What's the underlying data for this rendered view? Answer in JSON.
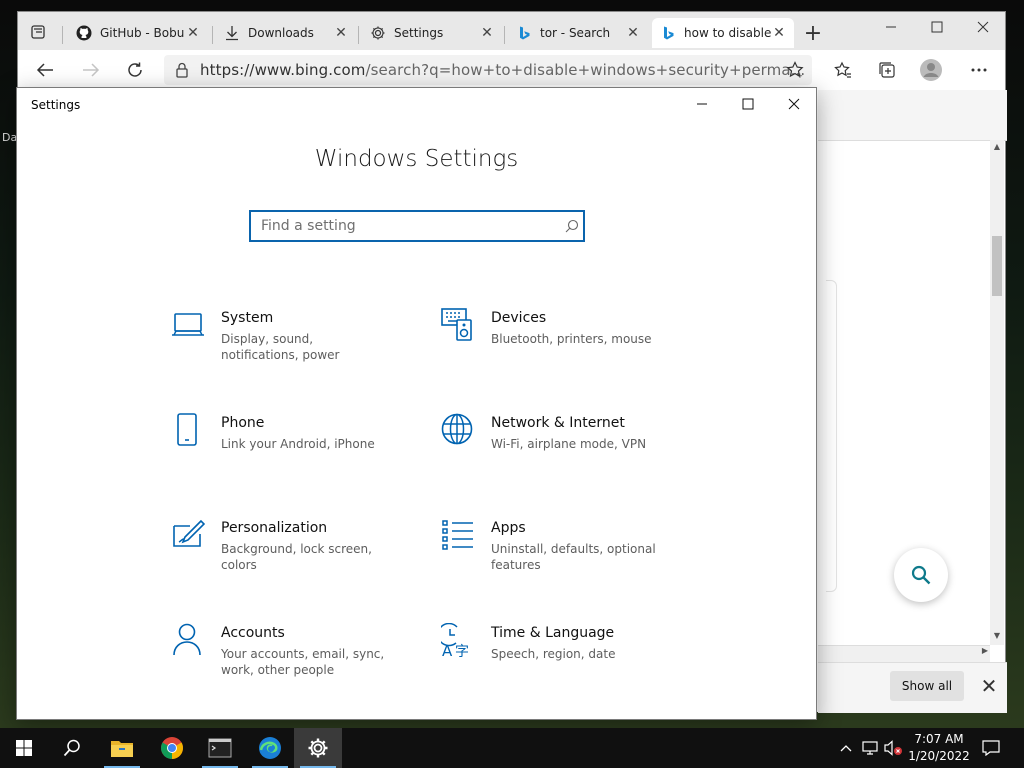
{
  "desktop": {
    "label": "Da"
  },
  "browser": {
    "tabs": [
      {
        "title": "GitHub - Bobu",
        "icon": "github-icon",
        "active": false
      },
      {
        "title": "Downloads",
        "icon": "download-icon",
        "active": false
      },
      {
        "title": "Settings",
        "icon": "gear-icon",
        "active": false
      },
      {
        "title": "tor - Search",
        "icon": "bing-icon",
        "active": false
      },
      {
        "title": "how to disable",
        "icon": "bing-icon",
        "active": true
      }
    ],
    "url_base": "https://www.bing.com",
    "url_rest": "/search?q=how+to+disable+windows+security+perma...",
    "download_bar": {
      "show_all": "Show all"
    }
  },
  "settings": {
    "window_title": "Settings",
    "heading": "Windows Settings",
    "search_placeholder": "Find a setting",
    "categories": [
      {
        "name": "System",
        "desc": "Display, sound, notifications, power",
        "icon": "laptop-icon"
      },
      {
        "name": "Devices",
        "desc": "Bluetooth, printers, mouse",
        "icon": "keyboard-speaker-icon"
      },
      {
        "name": "Phone",
        "desc": "Link your Android, iPhone",
        "icon": "phone-icon"
      },
      {
        "name": "Network & Internet",
        "desc": "Wi-Fi, airplane mode, VPN",
        "icon": "globe-icon"
      },
      {
        "name": "Personalization",
        "desc": "Background, lock screen, colors",
        "icon": "paint-brush-icon"
      },
      {
        "name": "Apps",
        "desc": "Uninstall, defaults, optional features",
        "icon": "apps-list-icon"
      },
      {
        "name": "Accounts",
        "desc": "Your accounts, email, sync, work, other people",
        "icon": "person-icon"
      },
      {
        "name": "Time & Language",
        "desc": "Speech, region, date",
        "icon": "time-language-icon"
      }
    ],
    "accent": "#0063b1"
  },
  "taskbar": {
    "apps": [
      "start-icon",
      "search-icon",
      "file-explorer-icon",
      "chrome-icon",
      "terminal-icon",
      "edge-icon",
      "settings-icon"
    ],
    "time": "7:07 AM",
    "date": "1/20/2022"
  }
}
